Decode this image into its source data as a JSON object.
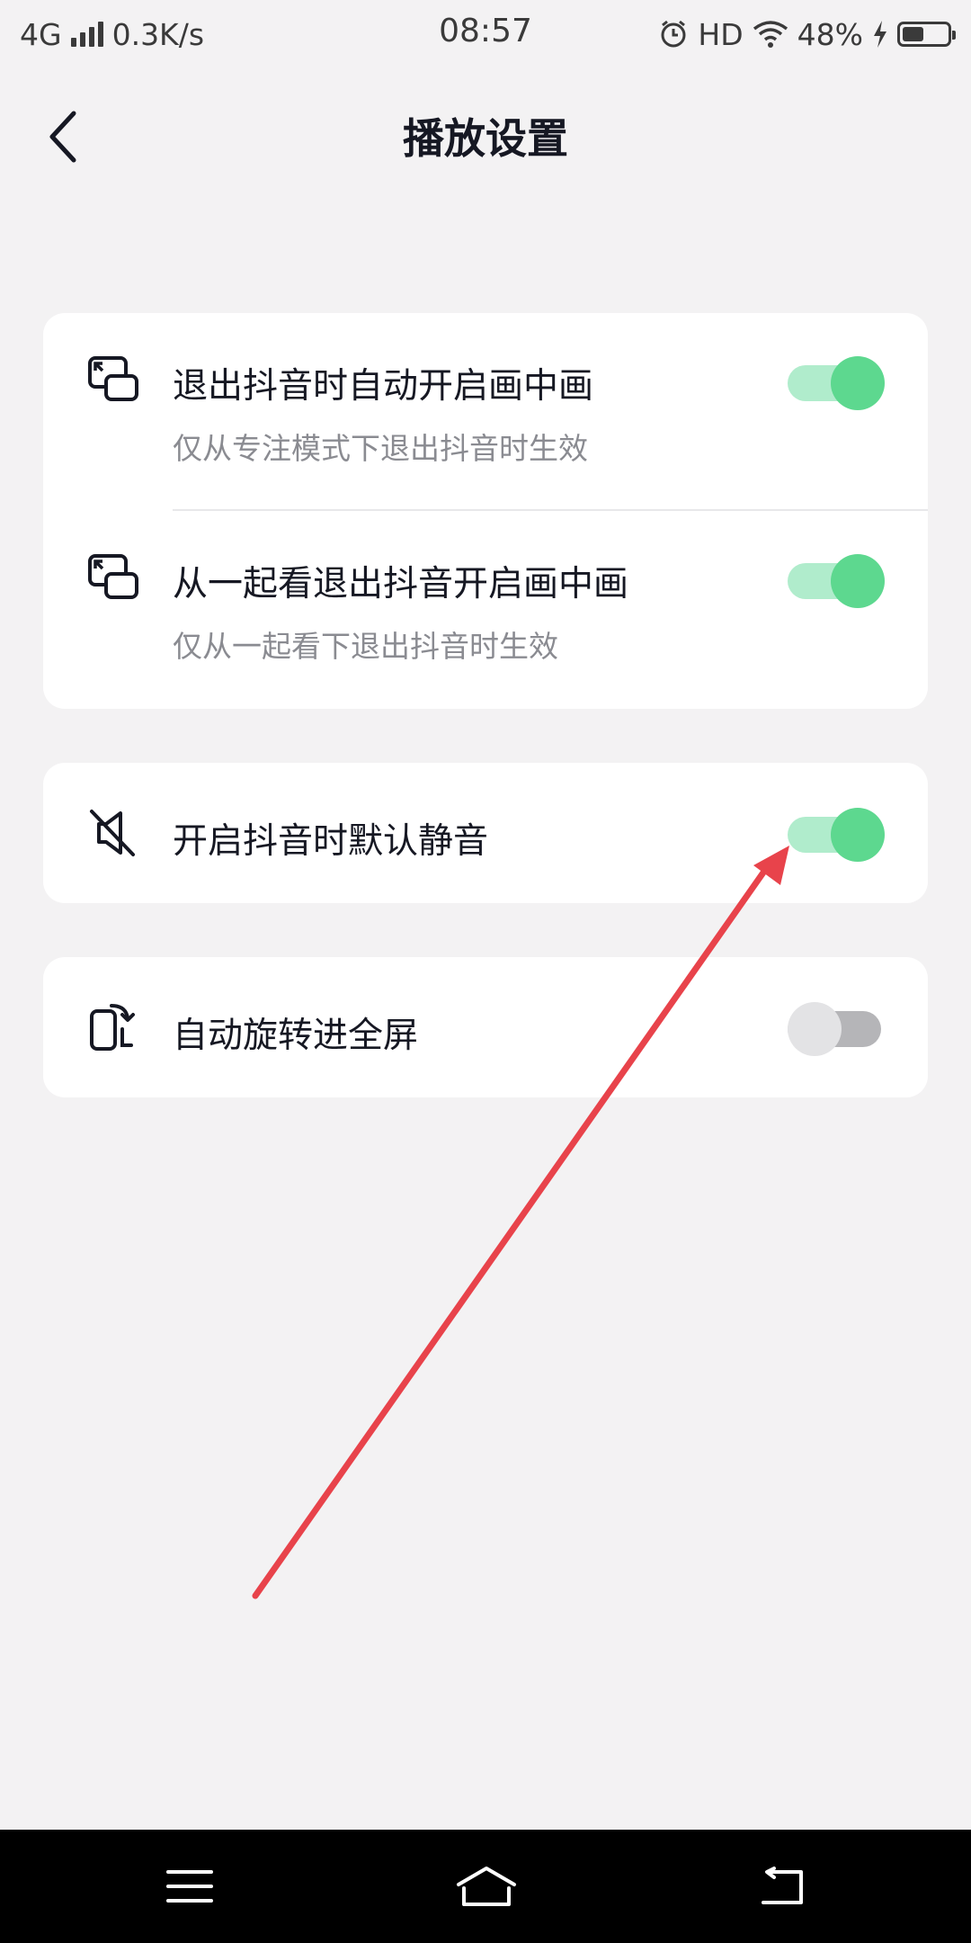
{
  "status_bar": {
    "network": "4G",
    "speed": "0.3K/s",
    "time": "08:57",
    "hd": "HD",
    "battery_percent": "48%",
    "battery_level": 0.48
  },
  "header": {
    "title": "播放设置"
  },
  "settings": {
    "pip_exit": {
      "title": "退出抖音时自动开启画中画",
      "subtitle": "仅从专注模式下退出抖音时生效",
      "enabled": true
    },
    "pip_watch_together": {
      "title": "从一起看退出抖音开启画中画",
      "subtitle": "仅从一起看下退出抖音时生效",
      "enabled": true
    },
    "mute_default": {
      "title": "开启抖音时默认静音",
      "enabled": true
    },
    "auto_rotate": {
      "title": "自动旋转进全屏",
      "enabled": false
    }
  },
  "colors": {
    "toggle_on_knob": "#5dd88f",
    "toggle_on_track": "#b0eccc",
    "toggle_off_knob": "#e3e3e5",
    "toggle_off_track": "#b5b5b8",
    "annotation_arrow": "#e8434b"
  },
  "icons": {
    "back": "chevron-left-icon",
    "pip": "picture-in-picture-icon",
    "mute": "speaker-muted-icon",
    "rotate": "rotate-screen-icon",
    "menu": "menu-icon",
    "home": "home-icon",
    "back_nav": "return-icon"
  }
}
